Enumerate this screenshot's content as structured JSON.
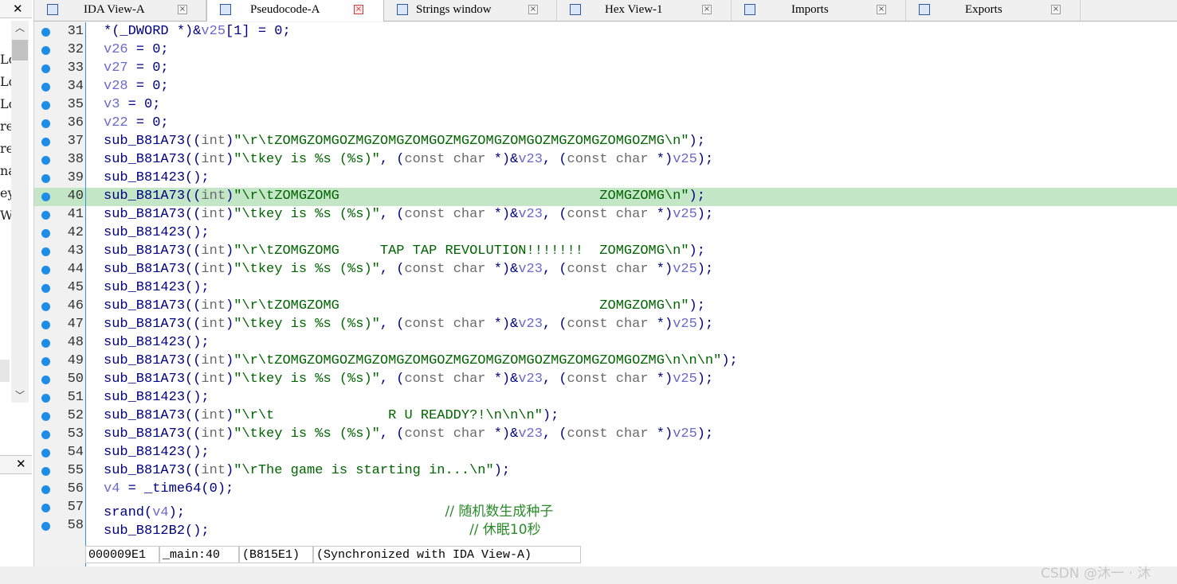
{
  "tabs": [
    {
      "label": "IDA View-A",
      "icon": "ida-view-icon",
      "active": false
    },
    {
      "label": "Pseudocode-A",
      "icon": "pseudocode-icon",
      "active": true
    },
    {
      "label": "Strings window",
      "icon": "strings-icon",
      "active": false
    },
    {
      "label": "Hex View-1",
      "icon": "hex-view-icon",
      "active": false
    },
    {
      "label": "Imports",
      "icon": "imports-icon",
      "active": false
    },
    {
      "label": "Exports",
      "icon": "exports-icon",
      "active": false
    }
  ],
  "left_panel": {
    "fragments": [
      "Lo",
      "Lo",
      "Lo",
      "re",
      "re",
      "na",
      "ey",
      "Wr"
    ]
  },
  "highlighted_line": 40,
  "lines": [
    {
      "num": "31",
      "tokens": [
        [
          "p",
          "*(_DWORD *)&"
        ],
        [
          "v",
          "v25"
        ],
        [
          "p",
          "[1] = 0;"
        ]
      ]
    },
    {
      "num": "32",
      "tokens": [
        [
          "v",
          "v26"
        ],
        [
          "p",
          " = 0;"
        ]
      ]
    },
    {
      "num": "33",
      "tokens": [
        [
          "v",
          "v27"
        ],
        [
          "p",
          " = 0;"
        ]
      ]
    },
    {
      "num": "34",
      "tokens": [
        [
          "v",
          "v28"
        ],
        [
          "p",
          " = 0;"
        ]
      ]
    },
    {
      "num": "35",
      "tokens": [
        [
          "v",
          "v3"
        ],
        [
          "p",
          " = 0;"
        ]
      ]
    },
    {
      "num": "36",
      "tokens": [
        [
          "v",
          "v22"
        ],
        [
          "p",
          " = 0;"
        ]
      ]
    },
    {
      "num": "37",
      "tokens": [
        [
          "p",
          "sub_B81A73(("
        ],
        [
          "k",
          "int"
        ],
        [
          "p",
          ")"
        ],
        [
          "s",
          "\"\\r\\tZOMGZOMGOZMGZOMGZOMGOZMGZOMGZOMGOZMGZOMGZOMGOZMG\\n\""
        ],
        [
          "p",
          ");"
        ]
      ]
    },
    {
      "num": "38",
      "tokens": [
        [
          "p",
          "sub_B81A73(("
        ],
        [
          "k",
          "int"
        ],
        [
          "p",
          ")"
        ],
        [
          "s",
          "\"\\tkey is %s (%s)\""
        ],
        [
          "p",
          ", ("
        ],
        [
          "k",
          "const char"
        ],
        [
          "p",
          " *)&"
        ],
        [
          "v",
          "v23"
        ],
        [
          "p",
          ", ("
        ],
        [
          "k",
          "const char"
        ],
        [
          "p",
          " *)"
        ],
        [
          "v",
          "v25"
        ],
        [
          "p",
          ");"
        ]
      ]
    },
    {
      "num": "39",
      "tokens": [
        [
          "p",
          "sub_B81423();"
        ]
      ]
    },
    {
      "num": "40",
      "tokens": [
        [
          "p",
          "sub_B81A73(("
        ],
        [
          "k",
          "int"
        ],
        [
          "p",
          ")"
        ],
        [
          "s",
          "\"\\r\\tZOMGZOMG                                ZOMGZOMG\\n\""
        ],
        [
          "p",
          ");"
        ]
      ]
    },
    {
      "num": "41",
      "tokens": [
        [
          "p",
          "sub_B81A73(("
        ],
        [
          "k",
          "int"
        ],
        [
          "p",
          ")"
        ],
        [
          "s",
          "\"\\tkey is %s (%s)\""
        ],
        [
          "p",
          ", ("
        ],
        [
          "k",
          "const char"
        ],
        [
          "p",
          " *)&"
        ],
        [
          "v",
          "v23"
        ],
        [
          "p",
          ", ("
        ],
        [
          "k",
          "const char"
        ],
        [
          "p",
          " *)"
        ],
        [
          "v",
          "v25"
        ],
        [
          "p",
          ");"
        ]
      ]
    },
    {
      "num": "42",
      "tokens": [
        [
          "p",
          "sub_B81423();"
        ]
      ]
    },
    {
      "num": "43",
      "tokens": [
        [
          "p",
          "sub_B81A73(("
        ],
        [
          "k",
          "int"
        ],
        [
          "p",
          ")"
        ],
        [
          "s",
          "\"\\r\\tZOMGZOMG     TAP TAP REVOLUTION!!!!!!!  ZOMGZOMG\\n\""
        ],
        [
          "p",
          ");"
        ]
      ]
    },
    {
      "num": "44",
      "tokens": [
        [
          "p",
          "sub_B81A73(("
        ],
        [
          "k",
          "int"
        ],
        [
          "p",
          ")"
        ],
        [
          "s",
          "\"\\tkey is %s (%s)\""
        ],
        [
          "p",
          ", ("
        ],
        [
          "k",
          "const char"
        ],
        [
          "p",
          " *)&"
        ],
        [
          "v",
          "v23"
        ],
        [
          "p",
          ", ("
        ],
        [
          "k",
          "const char"
        ],
        [
          "p",
          " *)"
        ],
        [
          "v",
          "v25"
        ],
        [
          "p",
          ");"
        ]
      ]
    },
    {
      "num": "45",
      "tokens": [
        [
          "p",
          "sub_B81423();"
        ]
      ]
    },
    {
      "num": "46",
      "tokens": [
        [
          "p",
          "sub_B81A73(("
        ],
        [
          "k",
          "int"
        ],
        [
          "p",
          ")"
        ],
        [
          "s",
          "\"\\r\\tZOMGZOMG                                ZOMGZOMG\\n\""
        ],
        [
          "p",
          ");"
        ]
      ]
    },
    {
      "num": "47",
      "tokens": [
        [
          "p",
          "sub_B81A73(("
        ],
        [
          "k",
          "int"
        ],
        [
          "p",
          ")"
        ],
        [
          "s",
          "\"\\tkey is %s (%s)\""
        ],
        [
          "p",
          ", ("
        ],
        [
          "k",
          "const char"
        ],
        [
          "p",
          " *)&"
        ],
        [
          "v",
          "v23"
        ],
        [
          "p",
          ", ("
        ],
        [
          "k",
          "const char"
        ],
        [
          "p",
          " *)"
        ],
        [
          "v",
          "v25"
        ],
        [
          "p",
          ");"
        ]
      ]
    },
    {
      "num": "48",
      "tokens": [
        [
          "p",
          "sub_B81423();"
        ]
      ]
    },
    {
      "num": "49",
      "tokens": [
        [
          "p",
          "sub_B81A73(("
        ],
        [
          "k",
          "int"
        ],
        [
          "p",
          ")"
        ],
        [
          "s",
          "\"\\r\\tZOMGZOMGOZMGZOMGZOMGOZMGZOMGZOMGOZMGZOMGZOMGOZMG\\n\\n\\n\""
        ],
        [
          "p",
          ");"
        ]
      ]
    },
    {
      "num": "50",
      "tokens": [
        [
          "p",
          "sub_B81A73(("
        ],
        [
          "k",
          "int"
        ],
        [
          "p",
          ")"
        ],
        [
          "s",
          "\"\\tkey is %s (%s)\""
        ],
        [
          "p",
          ", ("
        ],
        [
          "k",
          "const char"
        ],
        [
          "p",
          " *)&"
        ],
        [
          "v",
          "v23"
        ],
        [
          "p",
          ", ("
        ],
        [
          "k",
          "const char"
        ],
        [
          "p",
          " *)"
        ],
        [
          "v",
          "v25"
        ],
        [
          "p",
          ");"
        ]
      ]
    },
    {
      "num": "51",
      "tokens": [
        [
          "p",
          "sub_B81423();"
        ]
      ]
    },
    {
      "num": "52",
      "tokens": [
        [
          "p",
          "sub_B81A73(("
        ],
        [
          "k",
          "int"
        ],
        [
          "p",
          ")"
        ],
        [
          "s",
          "\"\\r\\t              R U READDY?!\\n\\n\\n\""
        ],
        [
          "p",
          ");"
        ]
      ]
    },
    {
      "num": "53",
      "tokens": [
        [
          "p",
          "sub_B81A73(("
        ],
        [
          "k",
          "int"
        ],
        [
          "p",
          ")"
        ],
        [
          "s",
          "\"\\tkey is %s (%s)\""
        ],
        [
          "p",
          ", ("
        ],
        [
          "k",
          "const char"
        ],
        [
          "p",
          " *)&"
        ],
        [
          "v",
          "v23"
        ],
        [
          "p",
          ", ("
        ],
        [
          "k",
          "const char"
        ],
        [
          "p",
          " *)"
        ],
        [
          "v",
          "v25"
        ],
        [
          "p",
          ");"
        ]
      ]
    },
    {
      "num": "54",
      "tokens": [
        [
          "p",
          "sub_B81423();"
        ]
      ]
    },
    {
      "num": "55",
      "tokens": [
        [
          "p",
          "sub_B81A73(("
        ],
        [
          "k",
          "int"
        ],
        [
          "p",
          ")"
        ],
        [
          "s",
          "\"\\rThe game is starting in...\\n\""
        ],
        [
          "p",
          ");"
        ]
      ]
    },
    {
      "num": "56",
      "tokens": [
        [
          "v",
          "v4"
        ],
        [
          "p",
          " = _time64(0);"
        ]
      ]
    },
    {
      "num": "57",
      "tokens": [
        [
          "p",
          "srand("
        ],
        [
          "v",
          "v4"
        ],
        [
          "p",
          ");                                "
        ],
        [
          "c",
          "// 随机数生成种子"
        ]
      ]
    },
    {
      "num": "58",
      "tokens": [
        [
          "p",
          "sub_B812B2();                                "
        ],
        [
          "c",
          "// 休眠10秒"
        ]
      ]
    }
  ],
  "status": {
    "address": "000009E1",
    "location": "_main:40",
    "ea": "(B815E1)",
    "sync": "(Synchronized with IDA View-A)"
  },
  "watermark": "CSDN @沐一 · 沐",
  "colors": {
    "highlight": "#c3e6c6",
    "breakpoint_dot": "#1e8de8",
    "code_default": "#000080",
    "string": "#006400",
    "variable": "#6a6acb",
    "comment": "#2a8a2a"
  }
}
